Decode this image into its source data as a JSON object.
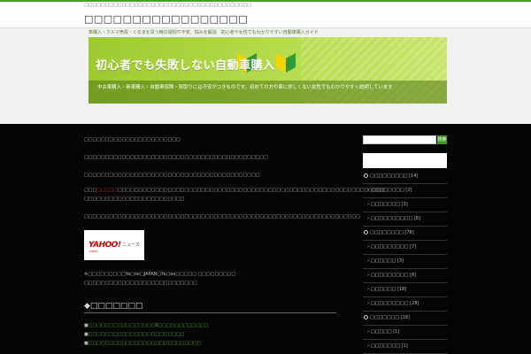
{
  "header": {
    "tagline": "□□□□□□□□□□□□□□□□□□□□□□□□□□□□□□□□□□□□□□□□",
    "site_title": "□□□□□□□□□□□□□□□□□",
    "description": "車購入・クルマ売買・くるまを買う時の疑問や不安、悩みを解消　初心者や女性でもわかりやすい自動車購入ガイド"
  },
  "banner": {
    "title": "初心者でも失敗しない自動車購入",
    "subtitle": "中古車購入・新車購入・自動車保険・買取りには不安がつきものです。初めての方や車に詳しくない女性でもわかりやすく説明しています"
  },
  "article": {
    "lines": [
      "□□□□□□□□□□□□□□□□□□□□□□□",
      "□□□□□□□□□□□□□□□□□□□□□□□□□□□□□□□□□□□□□□□□□□□□",
      "□□□□□□□□□□□□□□□□□□□□□□□□□□□□□□□□□□□□□□□□□□"
    ],
    "highlight_pre": "□□□",
    "highlight_red": "□□□□□",
    "highlight_post": "□□□□□□□□□□□□□□□□□□□□□□□□□□□□□□□□□□□□□□□□□□□□□□□□□□□□□□□□□□□□□□□□",
    "highlight_line2": "□□□□□□□□□□□□□□□□□□□□□□□□",
    "line_after": "□□□□□□□□□□□□□□□□□□□□□□□□□□□□□□□□□□□□□□□□□□□□□□□□□□□□□□□□□□□□□□□□□□",
    "yahoo_logo": "YAHOO!",
    "yahoo_sub": "JAPAN",
    "yahoo_news": "ニュース",
    "source_line1": "※□□□□□□□□□Ya□oo□JAPAN□Ya□oo□□□□□ □□□□□□□□□",
    "source_line2": "□□□□□□□□□□□□□□□□□□□□□□□□□□□",
    "related_heading": "◆□□□□□□□",
    "related_items": [
      "□□□□□□□□□□□□□□□□0□□□□□□□□□□□□",
      "□□□□□□□□□□□□□□□□□□□□□□□",
      "□□□□□□□□□□□□□□□□□□□□□□□□□□□"
    ]
  },
  "sidebar": {
    "search_button": "検索",
    "categories": [
      {
        "label": "□□□□□□□□□",
        "count": "[14]",
        "type": "parent"
      },
      {
        "label": "□□□□□□□□",
        "count": "[2]",
        "type": "child"
      },
      {
        "label": "□□□□□□□",
        "count": "[3]",
        "type": "child"
      },
      {
        "label": "□□□□□□□□□□",
        "count": "[8]",
        "type": "child"
      },
      {
        "label": "□□□□□□□□",
        "count": "[78]",
        "type": "parent"
      },
      {
        "label": "□□□□□□□□□",
        "count": "[7]",
        "type": "child"
      },
      {
        "label": "□□□□□□",
        "count": "[3]",
        "type": "child"
      },
      {
        "label": "□□□□□□□□□",
        "count": "[8]",
        "type": "child"
      },
      {
        "label": "□□□□□□",
        "count": "[18]",
        "type": "child"
      },
      {
        "label": "□□□□□□□□□",
        "count": "[28]",
        "type": "child"
      },
      {
        "label": "□□□□□□□",
        "count": "[18]",
        "type": "parent"
      },
      {
        "label": "□□□□□",
        "count": "[1]",
        "type": "child"
      },
      {
        "label": "□□□□□□□",
        "count": "[1]",
        "type": "child"
      }
    ]
  },
  "colors": {
    "accent_green": "#4a9d2a",
    "banner_green": "#9cca2f",
    "link_green": "#59b82e",
    "main_bg": "#050505",
    "highlight_red": "#e03030"
  }
}
